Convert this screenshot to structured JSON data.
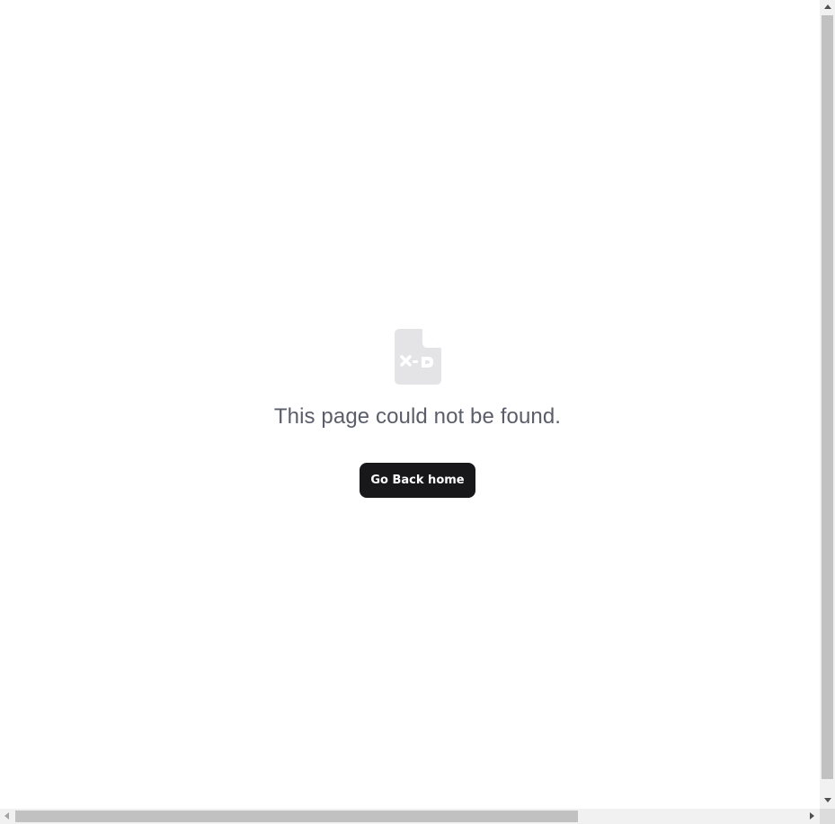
{
  "error_page": {
    "icon": "file-x-icon",
    "message": "This page could not be found.",
    "home_button_label": "Go Back home"
  },
  "colors": {
    "background": "#ffffff",
    "icon": "#e4e4e7",
    "message_text": "#5b5e6a",
    "button_bg": "#18181b",
    "button_text": "#ffffff"
  }
}
